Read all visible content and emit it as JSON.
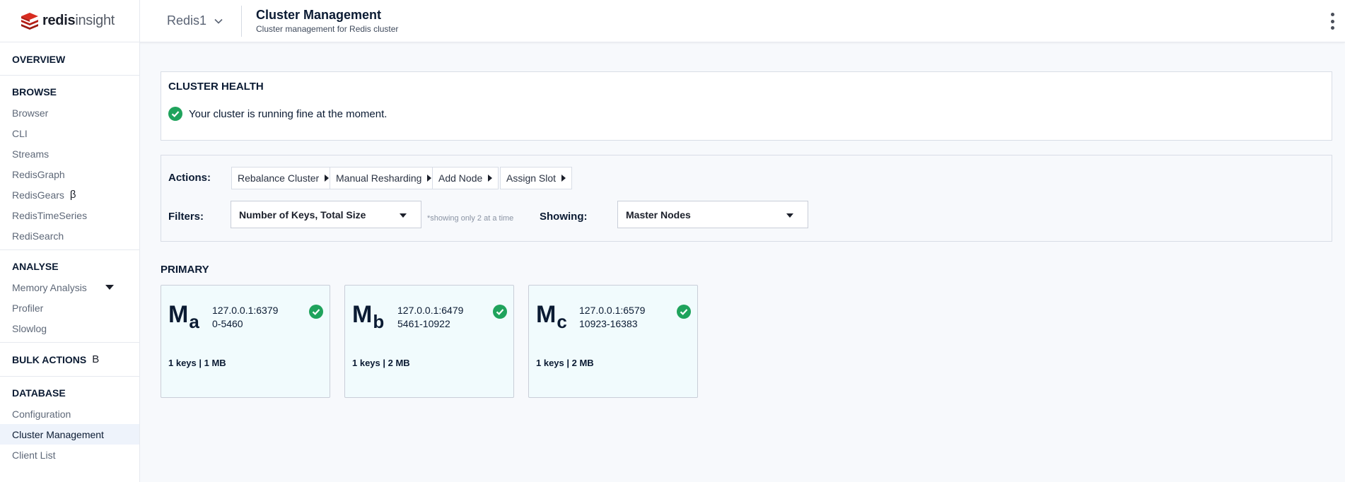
{
  "header": {
    "brand_strong": "redis",
    "brand_light": "insight",
    "database": "Redis1",
    "title": "Cluster Management",
    "subtitle": "Cluster management for Redis cluster"
  },
  "sidebar": {
    "overview": "OVERVIEW",
    "browse": {
      "heading": "BROWSE",
      "items": [
        "Browser",
        "CLI",
        "Streams",
        "RedisGraph",
        "RedisGears",
        "RedisTimeSeries",
        "RediSearch"
      ],
      "beta": "β"
    },
    "analyse": {
      "heading": "ANALYSE",
      "items": [
        "Memory Analysis",
        "Profiler",
        "Slowlog"
      ]
    },
    "bulk": {
      "heading": "BULK ACTIONS",
      "beta": "β"
    },
    "database": {
      "heading": "DATABASE",
      "items": [
        "Configuration",
        "Cluster Management",
        "Client List"
      ]
    }
  },
  "health": {
    "title": "CLUSTER HEALTH",
    "message": "Your cluster is running fine at the moment."
  },
  "actions": {
    "label": "Actions:",
    "buttons": [
      "Rebalance Cluster",
      "Manual Resharding",
      "Add Node",
      "Assign Slot"
    ]
  },
  "filters": {
    "label": "Filters:",
    "selected": "Number of Keys, Total Size",
    "hint": "*showing only 2 at a time",
    "showing_label": "Showing:",
    "showing_selected": "Master Nodes"
  },
  "primary": {
    "title": "PRIMARY",
    "nodes": [
      {
        "letter": "M",
        "sub": "a",
        "address": "127.0.0.1:6379",
        "slots": "0-5460",
        "stats": "1 keys | 1 MB"
      },
      {
        "letter": "M",
        "sub": "b",
        "address": "127.0.0.1:6479",
        "slots": "5461-10922",
        "stats": "1 keys | 2 MB"
      },
      {
        "letter": "M",
        "sub": "c",
        "address": "127.0.0.1:6579",
        "slots": "10923-16383",
        "stats": "1 keys | 2 MB"
      }
    ]
  },
  "colors": {
    "success": "#1fa35c",
    "logo": "#d82c20",
    "active_bg": "#eef3fb",
    "card_bg": "#f1fbfd"
  }
}
